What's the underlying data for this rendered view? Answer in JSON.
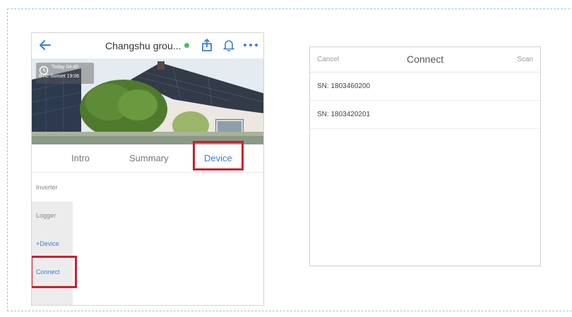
{
  "phone": {
    "title": "Changshu grou...",
    "status_color": "#4cba5c",
    "hero": {
      "line1": "Today 04:40",
      "line2": "BTC Sunset 19:06"
    },
    "tabs": [
      {
        "label": "Intro"
      },
      {
        "label": "Summary"
      },
      {
        "label": "Device"
      }
    ],
    "sidebar": [
      {
        "label": "Inverter"
      },
      {
        "label": "Logger"
      },
      {
        "label": "+Device"
      },
      {
        "label": "Connect"
      }
    ],
    "highlight_color": "#c8202f",
    "accent_color": "#3b7ddd"
  },
  "dialog": {
    "cancel_label": "Cancel",
    "title": "Connect",
    "scan_label": "Scan",
    "items": [
      {
        "label": "SN: 1803460200"
      },
      {
        "label": "SN: 1803420201"
      }
    ]
  }
}
